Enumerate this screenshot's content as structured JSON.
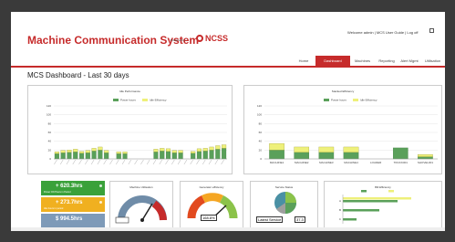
{
  "app": {
    "title": "Machine Communication System",
    "powered_by": "Powered by",
    "brand": "NCSS",
    "welcome": "Welcome admin | MCS User Guide | Log off"
  },
  "nav": {
    "tabs": [
      {
        "label": "Home",
        "active": false
      },
      {
        "label": "Dashboard",
        "active": true
      },
      {
        "label": "Machines",
        "active": false
      },
      {
        "label": "Reporting",
        "active": false
      },
      {
        "label": "Alert Mgmt",
        "active": false
      },
      {
        "label": "Utilisation",
        "active": false
      }
    ]
  },
  "page": {
    "title": "MCS Dashboard - Last 30 days"
  },
  "colors": {
    "accent": "#c62b2b",
    "series_green": "#5aa05a",
    "series_yellow": "#eef07a",
    "kpi_green": "#3aa13a",
    "kpi_yellow": "#f0b020",
    "kpi_blue": "#7e9ab8"
  },
  "kpis": [
    {
      "value": "+ 620.3hrs",
      "caption": "Power ON Hours in Period",
      "color": "#3aa13a"
    },
    {
      "value": "+ 273.7hrs",
      "caption": "Idle hours in period",
      "color": "#f0b020"
    },
    {
      "value": "$ 994.5hrs",
      "caption": "",
      "color": "#7e9ab8"
    }
  ],
  "gauges": [
    {
      "title": "Machine Utilisation",
      "value": "",
      "needle": 0.72
    },
    {
      "title": "Generator efficiency",
      "value": "168.8%",
      "needle": 0.85
    }
  ],
  "service": {
    "title": "Service Status",
    "value": "37.3",
    "label": "Latest Service"
  },
  "bar_mini": {
    "title": "Bill Efficiency"
  },
  "chart_data": [
    {
      "type": "bar",
      "title": "Idle Performance",
      "legend": [
        "Power hours",
        "Idle Efficiency"
      ],
      "ylim": [
        0,
        120
      ],
      "yticks": [
        "120",
        "100",
        "80",
        "60",
        "40",
        "20",
        "0"
      ],
      "series": [
        {
          "name": "Power hours",
          "values": [
            12,
            14,
            15,
            16,
            13,
            14,
            18,
            20,
            14,
            0,
            12,
            12,
            0,
            0,
            0,
            0,
            16,
            18,
            17,
            14,
            14,
            0,
            13,
            17,
            18,
            20,
            22,
            24
          ]
        },
        {
          "name": "Idle Efficiency",
          "values": [
            4,
            5,
            5,
            6,
            4,
            5,
            6,
            7,
            5,
            0,
            4,
            4,
            0,
            0,
            0,
            0,
            6,
            6,
            6,
            5,
            5,
            0,
            4,
            6,
            6,
            7,
            8,
            8
          ]
        }
      ]
    },
    {
      "type": "bar",
      "title": "Stacked Efficiency",
      "legend": [
        "Power hours",
        "Idle Efficiency"
      ],
      "ylim": [
        0,
        120
      ],
      "yticks": [
        "120",
        "100",
        "80",
        "60",
        "40",
        "20",
        "0"
      ],
      "categories": [
        "MACHINE1",
        "MACHINE2",
        "MACHINE3",
        "MACHINE4",
        "LOADER",
        "TRUCK001",
        "SHOVEL001"
      ],
      "series": [
        {
          "name": "Power hours",
          "values": [
            20,
            15,
            15,
            15,
            0,
            25,
            5
          ]
        },
        {
          "name": "Idle Efficiency",
          "values": [
            15,
            12,
            12,
            12,
            0,
            0,
            5
          ]
        }
      ]
    },
    {
      "type": "bar",
      "title": "Bill Efficiency",
      "categories": [
        "A",
        "B",
        "C"
      ],
      "series": [
        {
          "name": "Power hours",
          "values": [
            60,
            40,
            15
          ]
        },
        {
          "name": "Idle Efficiency",
          "values": [
            75,
            0,
            0
          ]
        }
      ]
    }
  ]
}
